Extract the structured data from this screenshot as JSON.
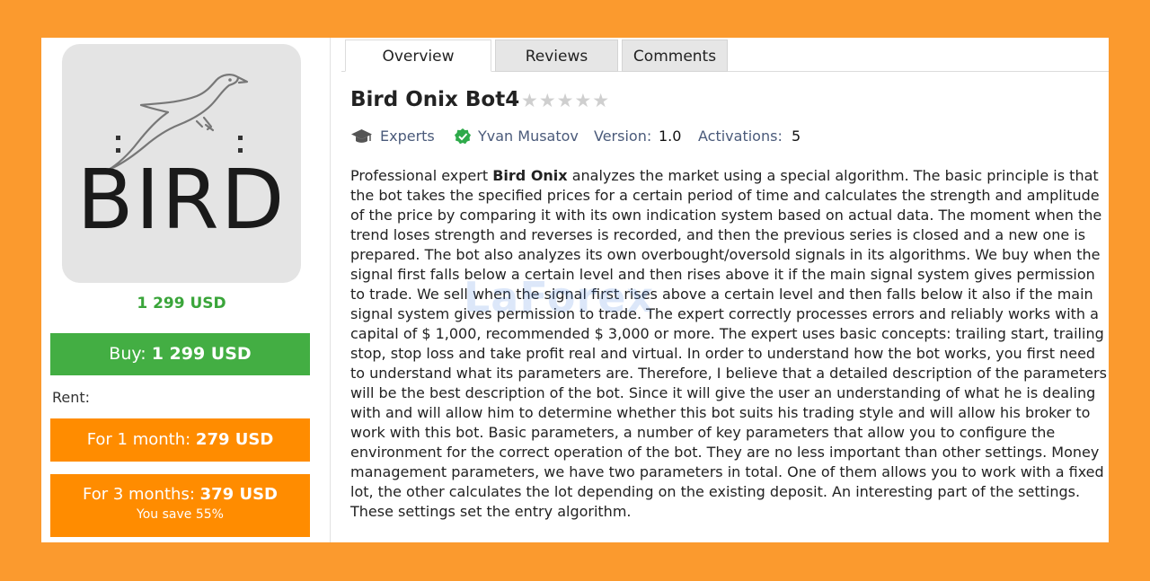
{
  "product": {
    "logo_text": "BIRD",
    "price": "1 299 USD",
    "title": "Bird Onix Bot4",
    "rating_stars": "★★★★★"
  },
  "purchase": {
    "buy_prefix": "Buy: ",
    "buy_amount": "1 299 USD",
    "rent_label": "Rent:",
    "rent_1_prefix": "For 1 month: ",
    "rent_1_amount": "279 USD",
    "rent_3_prefix": "For 3 months: ",
    "rent_3_amount": "379 USD",
    "rent_3_save": "You save 55%"
  },
  "tabs": [
    "Overview",
    "Reviews",
    "Comments"
  ],
  "meta": {
    "category": "Experts",
    "author": "Yvan Musatov",
    "version_label": "Version:",
    "version": "1.0",
    "activations_label": "Activations:",
    "activations": "5"
  },
  "description": {
    "intro": "Professional expert ",
    "name": "Bird Onix",
    "body": " analyzes the market using a special algorithm. The basic principle is that the bot takes the specified prices for a certain period of time and calculates the strength and amplitude of the price by comparing it with its own indication system based on actual data. The moment when the trend loses strength and reverses is recorded, and then the previous series is closed and a new one is prepared. The bot also analyzes its own overbought/oversold signals in its algorithms. We buy when the signal first falls below a certain level and then rises above it if the main signal system gives permission to trade. We sell when the signal first rises above a certain level and then falls below it also if the main signal system gives permission to trade. The expert correctly processes errors and reliably works with a capital of $ 1,000, recommended $ 3,000 or more. The expert uses basic concepts: trailing start, trailing stop, stop loss and take profit real and virtual. In order to understand how the bot works, you first need to understand what its parameters are. Therefore, I believe that a detailed description of the parameters will be the best description of the bot. Since it will give the user an understanding of what he is dealing with and will allow him to determine whether this bot suits his trading style and will allow his broker to work with this bot. Basic parameters, a number of key parameters that allow you to configure the environment for the correct operation of the bot. They are no less important than other settings. Money management parameters, we have two parameters in total. One of them allows you to work with a fixed lot, the other calculates the lot depending on the existing deposit. An interesting part of the settings. These settings set the entry algorithm."
  },
  "watermark": "LaForex",
  "colors": {
    "background": "#fb9a2e",
    "buy": "#43ae43",
    "rent": "#ff8c00",
    "price": "#3aa53a",
    "verified": "#2eaa4a"
  }
}
